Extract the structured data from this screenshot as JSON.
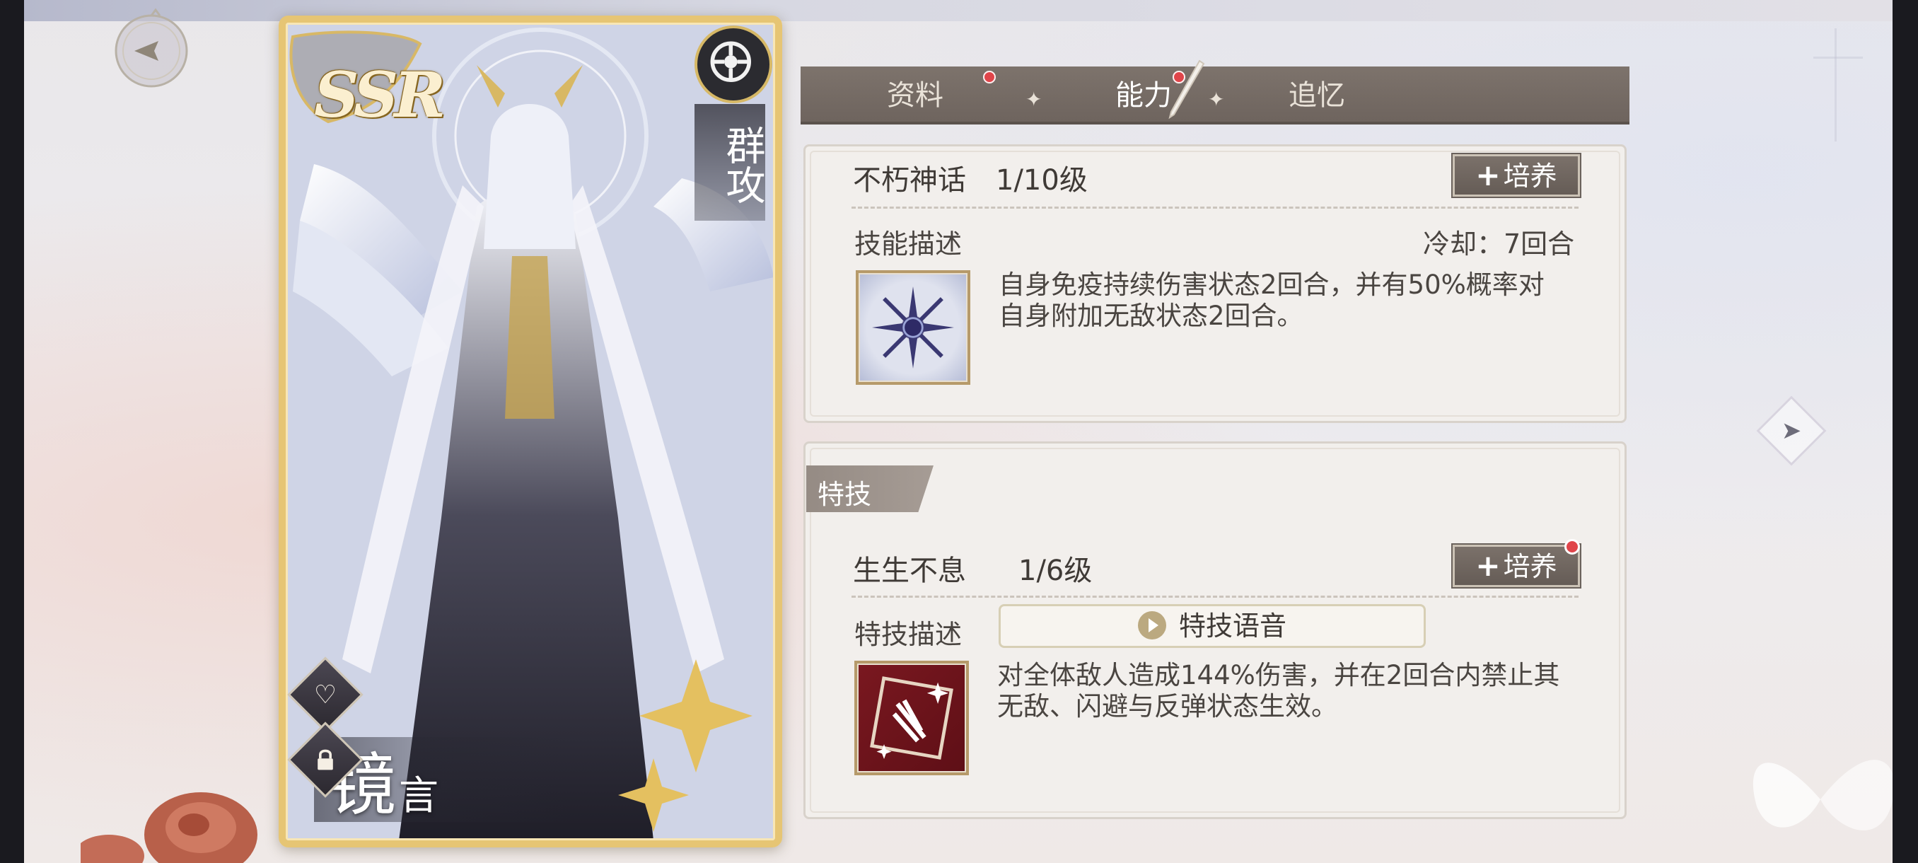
{
  "card": {
    "rarity": "SSR",
    "attack_type": "群攻",
    "name_main": "镜",
    "name_sub": "言"
  },
  "tabs": [
    {
      "label": "资料",
      "active": false,
      "badge": true
    },
    {
      "label": "能力",
      "active": true,
      "badge": true
    },
    {
      "label": "追忆",
      "active": false,
      "badge": false
    }
  ],
  "skill": {
    "title": "不朽神话",
    "level": "1/10级",
    "train_label": "培养",
    "desc_label": "技能描述",
    "cooldown": "冷却：7回合",
    "description_line1": "自身免疫持续伤害状态2回合，并有50%概率对",
    "description_line2": "自身附加无敌状态2回合。"
  },
  "special": {
    "section_label": "特技",
    "title": "生生不息",
    "level": "1/6级",
    "train_label": "培养",
    "desc_label": "特技描述",
    "voice_label": "特技语音",
    "description_line1": "对全体敌人造成144%伤害，并在2回合内禁止其",
    "description_line2": "无敌、闪避与反弹状态生效。"
  },
  "colors": {
    "tab_bg": "#6e645e",
    "badge_red": "#e0454a",
    "card_gold": "#e6c574",
    "panel_bg": "#f2efec"
  },
  "icons": {
    "back": "back-arrow-icon",
    "element": "element-icon",
    "favorite": "heart-icon",
    "lock": "lock-icon",
    "next": "next-arrow-icon",
    "play": "play-icon",
    "edit": "pen-icon"
  }
}
